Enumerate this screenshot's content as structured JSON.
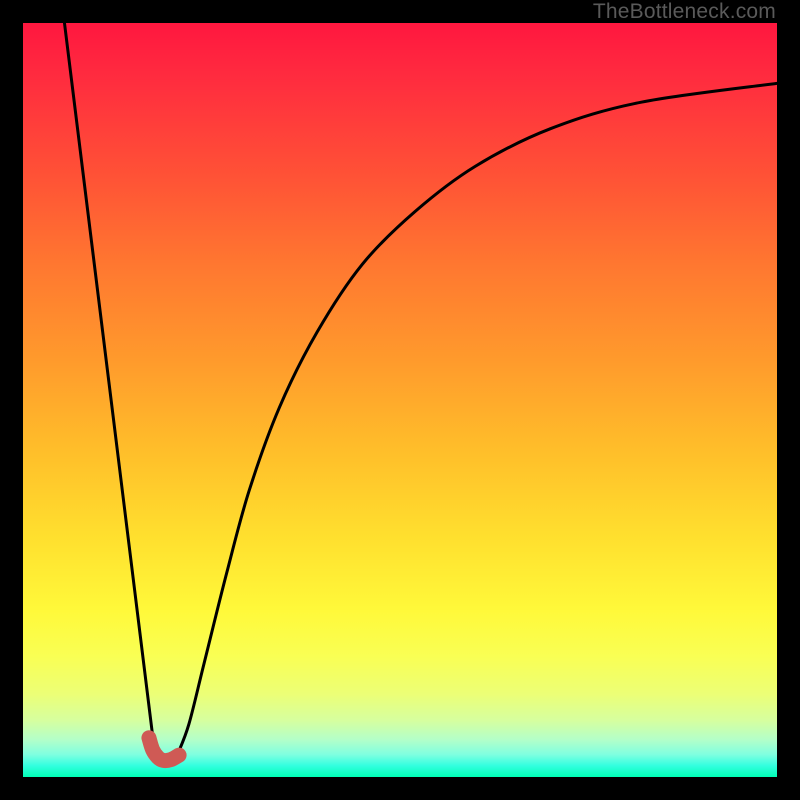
{
  "watermark": "TheBottleneck.com",
  "chart_data": {
    "type": "line",
    "title": "",
    "xlabel": "",
    "ylabel": "",
    "xlim": [
      0,
      100
    ],
    "ylim": [
      0,
      100
    ],
    "series": [
      {
        "name": "left-descent",
        "x": [
          5.5,
          17.5
        ],
        "values": [
          100,
          3
        ]
      },
      {
        "name": "right-curve",
        "x": [
          20.5,
          22,
          24,
          27,
          30,
          34,
          39,
          45,
          52,
          60,
          70,
          82,
          100
        ],
        "values": [
          3,
          7,
          15,
          27,
          38,
          49,
          59,
          68,
          75,
          81,
          86,
          89.5,
          92
        ]
      }
    ],
    "marker": {
      "name": "bottleneck-marker",
      "color": "#cf5a55",
      "points_x": [
        16.7,
        17.2,
        17.9,
        18.6,
        19.6,
        20.7
      ],
      "points_y": [
        5.2,
        3.6,
        2.6,
        2.2,
        2.3,
        2.9
      ]
    }
  }
}
